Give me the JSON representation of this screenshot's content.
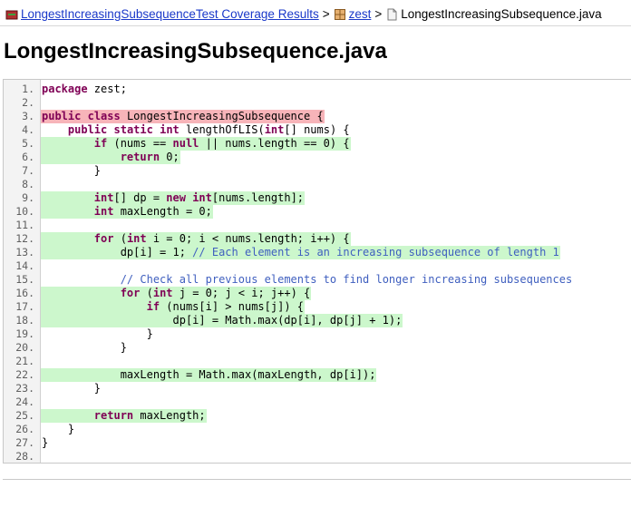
{
  "breadcrumb": {
    "report_link": "LongestIncreasingSubsequenceTest Coverage Results",
    "sep": ">",
    "package_link": "zest",
    "file": "LongestIncreasingSubsequence.java"
  },
  "page_title": "LongestIncreasingSubsequence.java",
  "colors": {
    "covered": "#ccf7cc",
    "not_covered": "#f7b4b9",
    "link": "#1a38c9",
    "keyword": "#7f0055",
    "comment": "#3f5fbf"
  },
  "code_lines": [
    {
      "num": "1.",
      "text": "package zest;",
      "coverage": "none-line",
      "branch": false
    },
    {
      "num": "2.",
      "text": "",
      "coverage": "blank",
      "branch": false
    },
    {
      "num": "3.",
      "text": "public class LongestIncreasingSubsequence {",
      "coverage": "missed",
      "branch": false
    },
    {
      "num": "4.",
      "text": "    public static int lengthOfLIS(int[] nums) {",
      "coverage": "none-line",
      "branch": false
    },
    {
      "num": "5.",
      "text": "        if (nums == null || nums.length == 0) {",
      "coverage": "covered",
      "branch": true
    },
    {
      "num": "6.",
      "text": "            return 0;",
      "coverage": "covered",
      "branch": false
    },
    {
      "num": "7.",
      "text": "        }",
      "coverage": "none-line",
      "branch": false
    },
    {
      "num": "8.",
      "text": "",
      "coverage": "blank",
      "branch": false
    },
    {
      "num": "9.",
      "text": "        int[] dp = new int[nums.length];",
      "coverage": "covered",
      "branch": false
    },
    {
      "num": "10.",
      "text": "        int maxLength = 0;",
      "coverage": "covered",
      "branch": false
    },
    {
      "num": "11.",
      "text": "",
      "coverage": "blank",
      "branch": false
    },
    {
      "num": "12.",
      "text": "        for (int i = 0; i < nums.length; i++) {",
      "coverage": "covered",
      "branch": true
    },
    {
      "num": "13.",
      "text": "            dp[i] = 1; // Each element is an increasing subsequence of length 1",
      "coverage": "covered",
      "branch": false
    },
    {
      "num": "14.",
      "text": "",
      "coverage": "blank",
      "branch": false
    },
    {
      "num": "15.",
      "text": "            // Check all previous elements to find longer increasing subsequences",
      "coverage": "none-line",
      "branch": false
    },
    {
      "num": "16.",
      "text": "            for (int j = 0; j < i; j++) {",
      "coverage": "covered",
      "branch": true
    },
    {
      "num": "17.",
      "text": "                if (nums[i] > nums[j]) {",
      "coverage": "covered",
      "branch": true
    },
    {
      "num": "18.",
      "text": "                    dp[i] = Math.max(dp[i], dp[j] + 1);",
      "coverage": "covered",
      "branch": false
    },
    {
      "num": "19.",
      "text": "                }",
      "coverage": "none-line",
      "branch": false
    },
    {
      "num": "20.",
      "text": "            }",
      "coverage": "none-line",
      "branch": false
    },
    {
      "num": "21.",
      "text": "",
      "coverage": "blank",
      "branch": false
    },
    {
      "num": "22.",
      "text": "            maxLength = Math.max(maxLength, dp[i]);",
      "coverage": "covered",
      "branch": false
    },
    {
      "num": "23.",
      "text": "        }",
      "coverage": "none-line",
      "branch": false
    },
    {
      "num": "24.",
      "text": "",
      "coverage": "blank",
      "branch": false
    },
    {
      "num": "25.",
      "text": "        return maxLength;",
      "coverage": "covered",
      "branch": false
    },
    {
      "num": "26.",
      "text": "    }",
      "coverage": "none-line",
      "branch": false
    },
    {
      "num": "27.",
      "text": "}",
      "coverage": "none-line",
      "branch": false
    },
    {
      "num": "28.",
      "text": "",
      "coverage": "blank",
      "branch": false
    }
  ]
}
